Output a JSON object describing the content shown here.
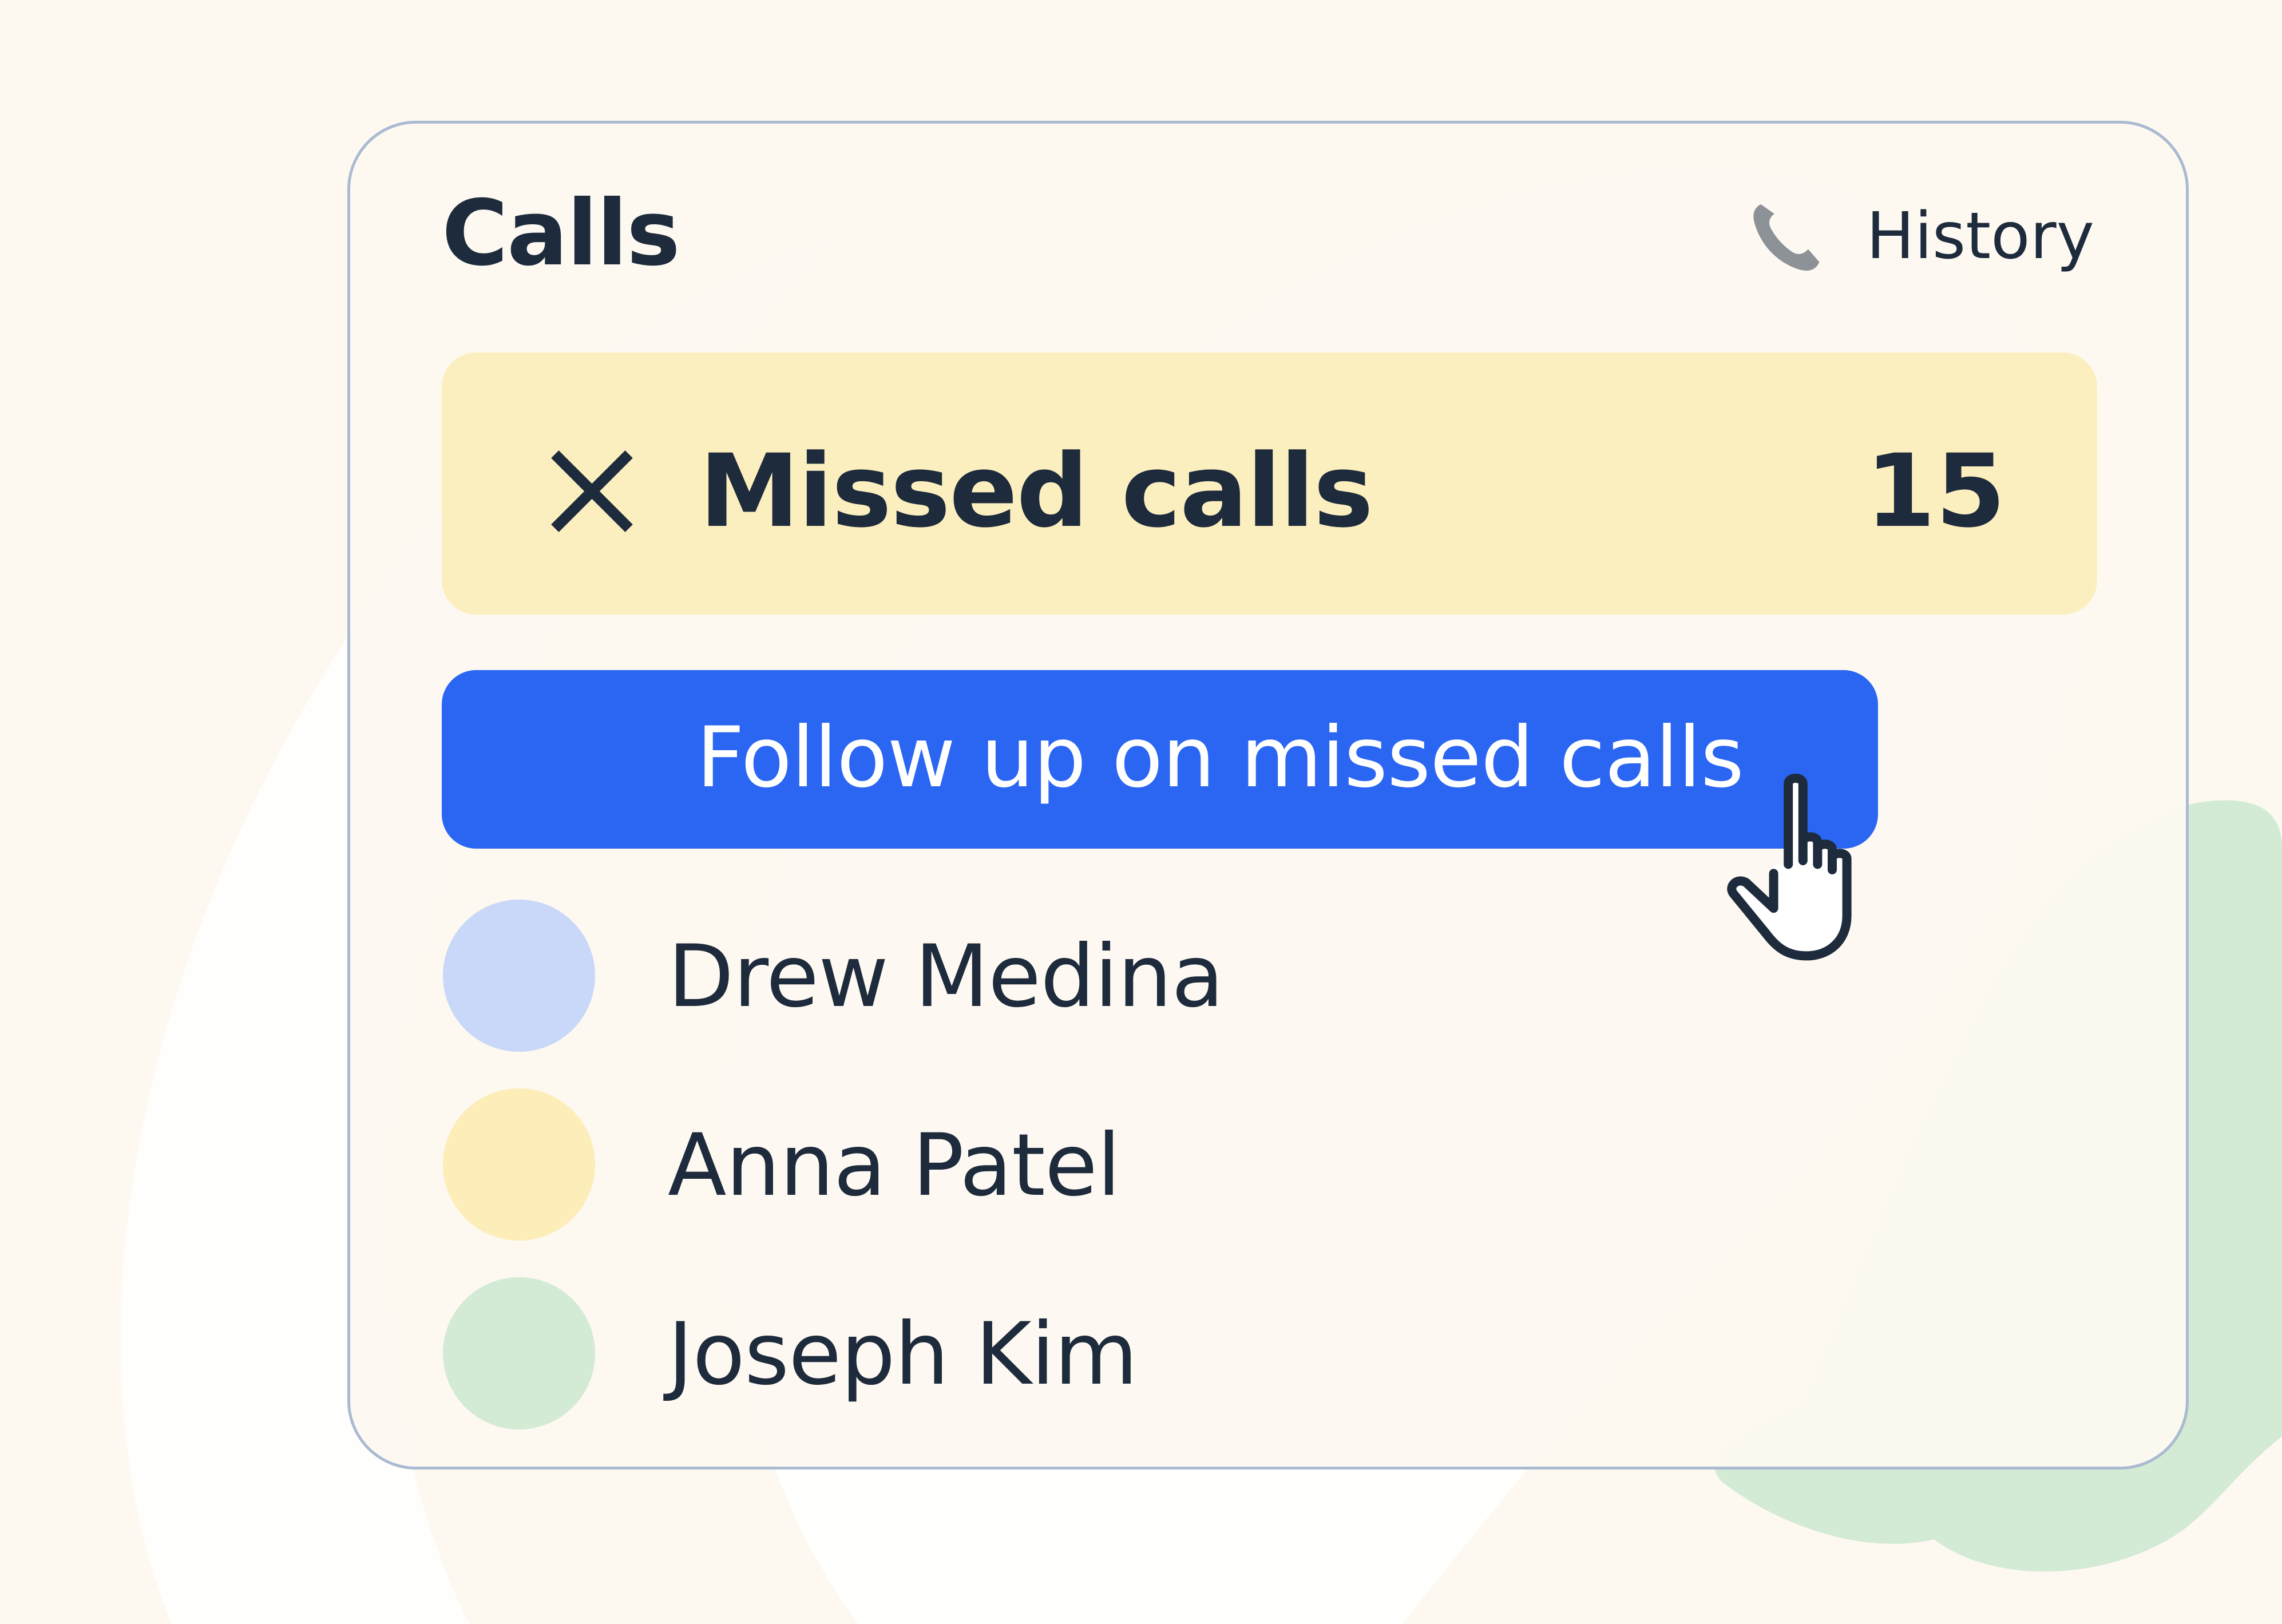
{
  "header": {
    "title": "Calls",
    "history_label": "History",
    "history_icon": "phone-icon"
  },
  "missed": {
    "icon": "close-icon",
    "label": "Missed calls",
    "count": "15",
    "background_color": "#fcefbf"
  },
  "action": {
    "label": "Follow up on missed calls",
    "color": "#2b66f3"
  },
  "contacts": [
    {
      "name": "Drew Medina",
      "avatar_color": "#c9d8f8"
    },
    {
      "name": "Anna Patel",
      "avatar_color": "#fcedb9"
    },
    {
      "name": "Joseph Kim",
      "avatar_color": "#d3ead4"
    }
  ],
  "cursor": {
    "icon": "hand-pointer-icon"
  }
}
